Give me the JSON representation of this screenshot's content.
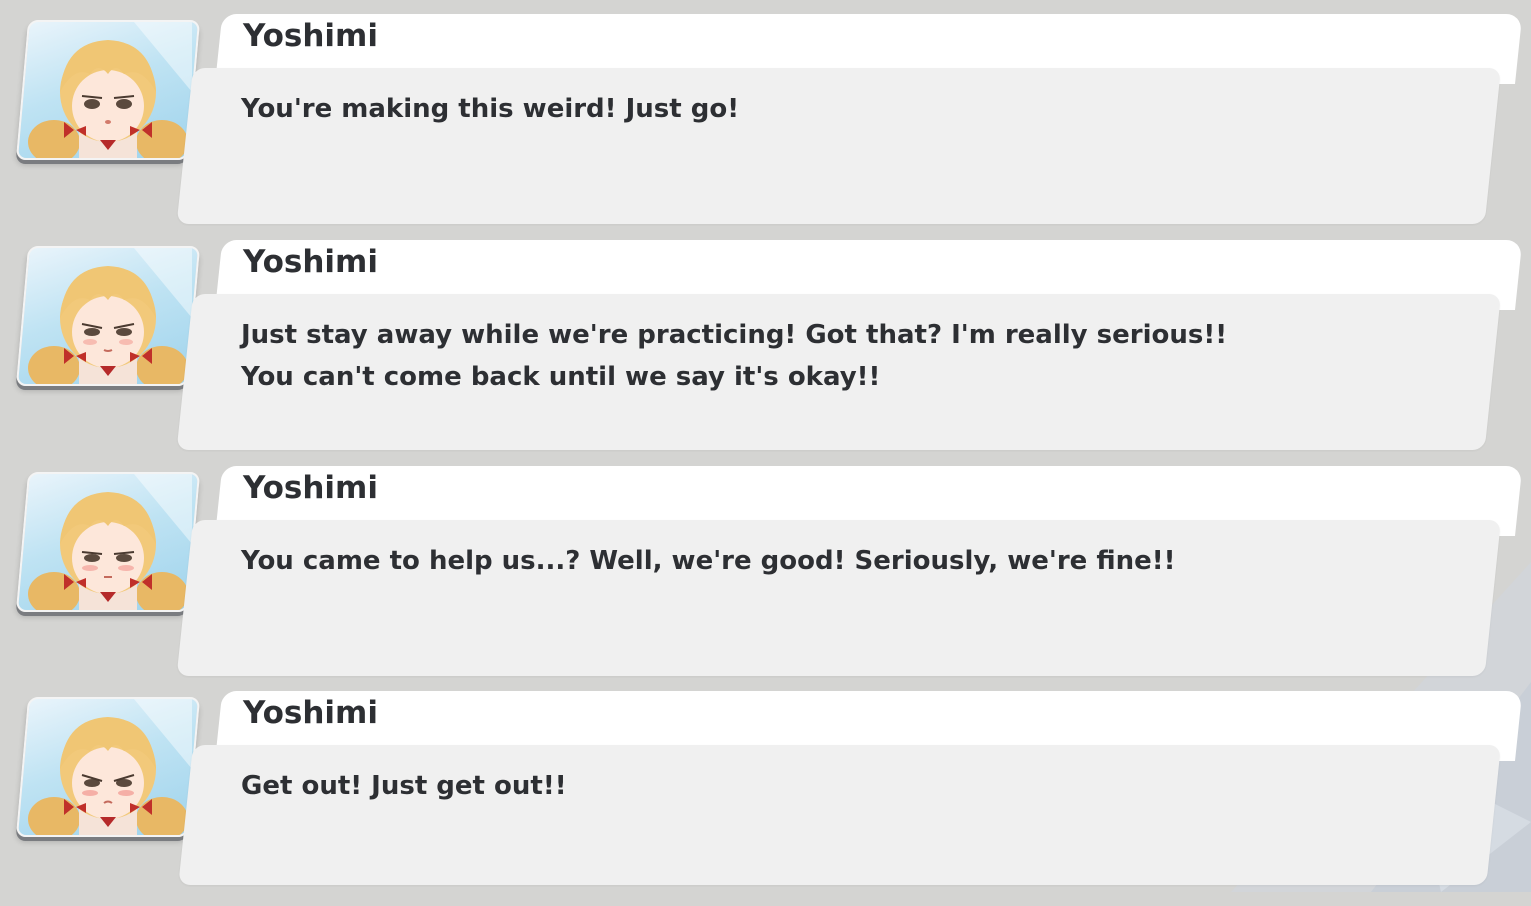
{
  "entries": [
    {
      "speaker": "Yoshimi",
      "text": "You're making this weird! Just go!"
    },
    {
      "speaker": "Yoshimi",
      "text": "Just stay away while we're practicing! Got that? I'm really serious!! You can't come back until we say it's okay!!"
    },
    {
      "speaker": "Yoshimi",
      "text": "You came to help us...? Well, we're good! Seriously, we're fine!!"
    },
    {
      "speaker": "Yoshimi",
      "text": "Get out! Just get out!!"
    }
  ],
  "colors": {
    "background": "#d4d4d2",
    "name_card": "#ffffff",
    "dialogue_box": "#f0f0f0",
    "text": "#2d2f33"
  }
}
